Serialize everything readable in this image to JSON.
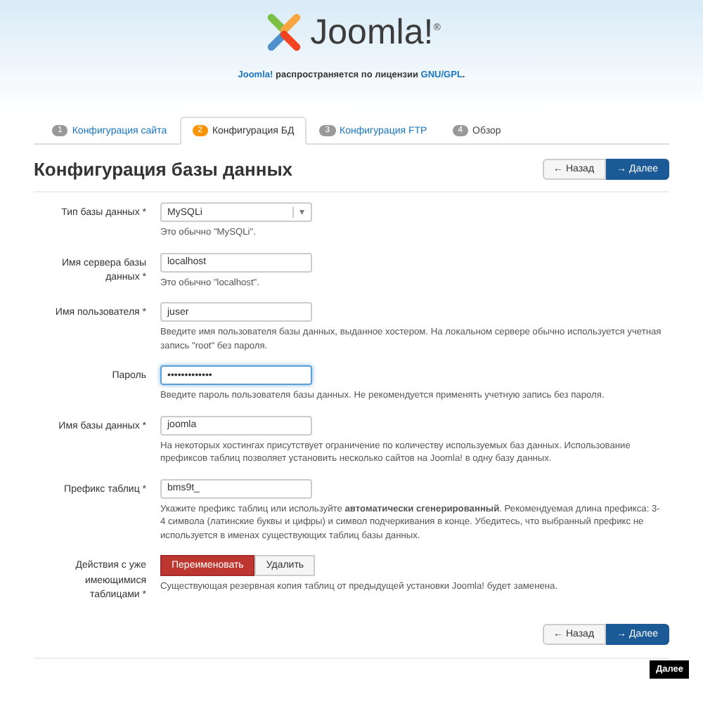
{
  "header": {
    "logo": "Joomla!",
    "logo_mark": "®",
    "license": {
      "link_1": "Joomla!",
      "text": " распространяется по лицензии ",
      "link_2": "GNU/GPL",
      "end": "."
    }
  },
  "tabs": [
    {
      "number": "1",
      "label": "Конфигурация сайта",
      "selected": false,
      "disabled": false
    },
    {
      "number": "2",
      "label": "Конфигурация БД",
      "selected": true,
      "disabled": false
    },
    {
      "number": "3",
      "label": "Конфигурация FTP",
      "selected": false,
      "disabled": false
    },
    {
      "number": "4",
      "label": "Обзор",
      "selected": false,
      "disabled": true
    }
  ],
  "title": "Конфигурация базы данных",
  "nav_buttons": {
    "back_icon": "←",
    "back": "Назад",
    "next_icon": "→",
    "next": "Далее"
  },
  "fields": [
    {
      "kind": "select",
      "label": "Тип базы данных *",
      "value": "MySQLi",
      "caret": "▾",
      "help": "Это обычно \"MySQLi\"."
    },
    {
      "kind": "text",
      "label": "Имя сервера базы данных *",
      "value": "localhost",
      "help": "Это обычно \"localhost\"."
    },
    {
      "kind": "text",
      "label": "Имя пользователя *",
      "value": "juser",
      "help": "Введите имя пользователя базы данных, выданное хостером. На локальном сервере обычно используется учетная запись \"root\" без пароля."
    },
    {
      "kind": "password",
      "label": "Пароль",
      "value": "•••••••••••••",
      "focused": true,
      "help": "Введите пароль пользователя базы данных. Не рекомендуется применять учетную запись без пароля."
    },
    {
      "kind": "text",
      "label": "Имя базы данных *",
      "value": "joomla",
      "help": "На некоторых хостингах присутствует ограничение по количеству используемых баз данных. Использование префиксов таблиц позволяет установить несколько сайтов на Joomla! в одну базу данных."
    },
    {
      "kind": "text",
      "label": "Префикс таблиц *",
      "value": "bms9t_",
      "help": "Укажите префикс таблиц или используйте **автоматически сгенерированный**. Рекомендуемая длина префикса: 3-4 символа (латинские буквы и цифры) и символ подчеркивания в конце. Убедитесь, что выбранный префикс не используется в именах существующих таблиц базы данных."
    },
    {
      "kind": "toggle",
      "label": "Действия с уже имеющимися таблицами *",
      "options": [
        {
          "label": "Переименовать",
          "selected": true
        },
        {
          "label": "Удалить",
          "selected": false
        }
      ],
      "help": "Существующая резервная копия таблиц от предыдущей установки Joomla! будет заменена."
    }
  ],
  "bottom_buttons": {
    "back_icon": "←",
    "back": "Назад",
    "next_icon": "→",
    "next": "Далее"
  },
  "tooltip": "Далее"
}
